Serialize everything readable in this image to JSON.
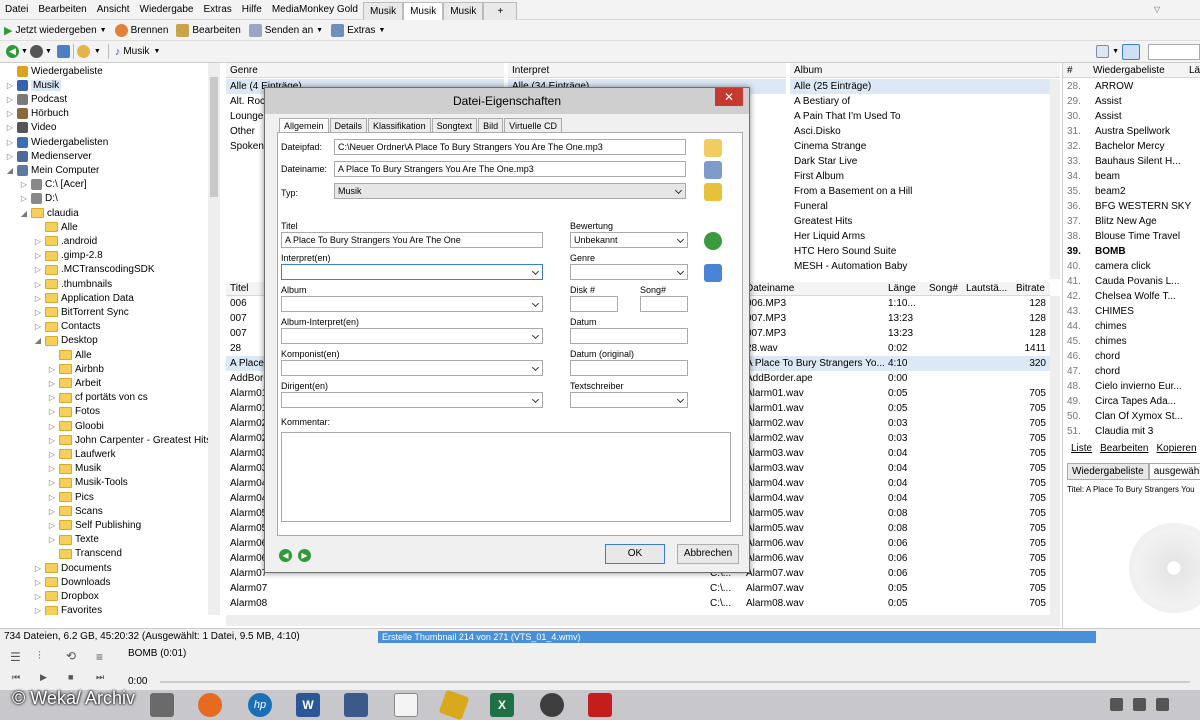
{
  "menu": {
    "items": [
      "Datei",
      "Bearbeiten",
      "Ansicht",
      "Wiedergabe",
      "Extras",
      "Hilfe",
      "MediaMonkey Gold"
    ],
    "tabs": [
      "Musik",
      "Musik",
      "Musik"
    ],
    "add_tab": "+"
  },
  "toolbar": {
    "play_now": "Jetzt wiedergeben",
    "burn": "Brennen",
    "edit": "Bearbeiten",
    "send_to": "Senden an",
    "extras": "Extras"
  },
  "nav": {
    "location": "Musik"
  },
  "tree": [
    {
      "label": "Wiedergabeliste",
      "d": 0,
      "exp": "",
      "icon": "now-playing-icon"
    },
    {
      "label": "Musik",
      "d": 0,
      "exp": "▷",
      "icon": "music-note-icon"
    },
    {
      "label": "Podcast",
      "d": 0,
      "exp": "▷",
      "icon": "podcast-icon"
    },
    {
      "label": "Hörbuch",
      "d": 0,
      "exp": "▷",
      "icon": "audiobook-icon"
    },
    {
      "label": "Video",
      "d": 0,
      "exp": "▷",
      "icon": "video-icon"
    },
    {
      "label": "Wiedergabelisten",
      "d": 0,
      "exp": "▷",
      "icon": "playlists-icon"
    },
    {
      "label": "Medienserver",
      "d": 0,
      "exp": "▷",
      "icon": "media-server-icon"
    },
    {
      "label": "Mein Computer",
      "d": 0,
      "exp": "◢",
      "icon": "computer-icon"
    },
    {
      "label": "C:\\ [Acer]",
      "d": 1,
      "exp": "▷",
      "icon": "drive-icon"
    },
    {
      "label": "D:\\",
      "d": 1,
      "exp": "▷",
      "icon": "drive-icon"
    },
    {
      "label": "claudia",
      "d": 1,
      "exp": "◢",
      "icon": "folder-icon"
    },
    {
      "label": "Alle",
      "d": 2,
      "exp": "",
      "icon": "folder-icon"
    },
    {
      "label": ".android",
      "d": 2,
      "exp": "▷",
      "icon": "folder-icon"
    },
    {
      "label": ".gimp-2.8",
      "d": 2,
      "exp": "▷",
      "icon": "folder-icon"
    },
    {
      "label": ".MCTranscodingSDK",
      "d": 2,
      "exp": "▷",
      "icon": "folder-icon"
    },
    {
      "label": ".thumbnails",
      "d": 2,
      "exp": "▷",
      "icon": "folder-icon"
    },
    {
      "label": "Application Data",
      "d": 2,
      "exp": "▷",
      "icon": "folder-icon"
    },
    {
      "label": "BitTorrent Sync",
      "d": 2,
      "exp": "▷",
      "icon": "folder-icon"
    },
    {
      "label": "Contacts",
      "d": 2,
      "exp": "▷",
      "icon": "folder-icon"
    },
    {
      "label": "Desktop",
      "d": 2,
      "exp": "◢",
      "icon": "folder-icon"
    },
    {
      "label": "Alle",
      "d": 3,
      "exp": "",
      "icon": "folder-icon"
    },
    {
      "label": "Airbnb",
      "d": 3,
      "exp": "▷",
      "icon": "folder-icon"
    },
    {
      "label": "Arbeit",
      "d": 3,
      "exp": "▷",
      "icon": "folder-icon"
    },
    {
      "label": "cf portäts von cs",
      "d": 3,
      "exp": "▷",
      "icon": "folder-icon"
    },
    {
      "label": "Fotos",
      "d": 3,
      "exp": "▷",
      "icon": "folder-icon"
    },
    {
      "label": "Gloobi",
      "d": 3,
      "exp": "▷",
      "icon": "folder-icon"
    },
    {
      "label": "John Carpenter - Greatest Hits",
      "d": 3,
      "exp": "▷",
      "icon": "folder-icon"
    },
    {
      "label": "Laufwerk",
      "d": 3,
      "exp": "▷",
      "icon": "folder-icon"
    },
    {
      "label": "Musik",
      "d": 3,
      "exp": "▷",
      "icon": "folder-icon"
    },
    {
      "label": "Musik-Tools",
      "d": 3,
      "exp": "▷",
      "icon": "folder-icon"
    },
    {
      "label": "Pics",
      "d": 3,
      "exp": "▷",
      "icon": "folder-icon"
    },
    {
      "label": "Scans",
      "d": 3,
      "exp": "▷",
      "icon": "folder-icon"
    },
    {
      "label": "Self Publishing",
      "d": 3,
      "exp": "▷",
      "icon": "folder-icon"
    },
    {
      "label": "Texte",
      "d": 3,
      "exp": "▷",
      "icon": "folder-icon"
    },
    {
      "label": "Transcend",
      "d": 3,
      "exp": "",
      "icon": "folder-icon"
    },
    {
      "label": "Documents",
      "d": 2,
      "exp": "▷",
      "icon": "folder-icon"
    },
    {
      "label": "Downloads",
      "d": 2,
      "exp": "▷",
      "icon": "folder-icon"
    },
    {
      "label": "Dropbox",
      "d": 2,
      "exp": "▷",
      "icon": "folder-icon"
    },
    {
      "label": "Favorites",
      "d": 2,
      "exp": "▷",
      "icon": "folder-icon"
    }
  ],
  "genre": {
    "header": "Genre",
    "items": [
      "Alle (4 Einträge)",
      "Alt. Rock",
      "Lounge",
      "Other",
      "Spoken"
    ]
  },
  "artist": {
    "header": "Interpret",
    "items": [
      "Alle (34 Einträge)"
    ]
  },
  "album": {
    "header": "Album",
    "items": [
      "Alle (25 Einträge)",
      "A Bestiary of",
      "A Pain That I'm Used To",
      "Asci.Disko",
      "Cinema Strange",
      "Dark Star Live",
      "First Album",
      "From a Basement on a Hill",
      "Funeral",
      "Greatest Hits",
      "Her Liquid Arms",
      "HTC Hero Sound Suite",
      "MESH - Automation Baby"
    ]
  },
  "tracks": {
    "headers": {
      "title": "Titel",
      "filename": "Dateiname",
      "length": "Länge",
      "song": "Song#",
      "loud": "Lautstä...",
      "bitrate": "Bitrate"
    },
    "rows": [
      {
        "title": "006",
        "path": "",
        "file": "006.MP3",
        "len": "1:10...",
        "br": "128"
      },
      {
        "title": "007",
        "path": "",
        "file": "007.MP3",
        "len": "13:23",
        "br": "128"
      },
      {
        "title": "007",
        "path": "",
        "file": "007.MP3",
        "len": "13:23",
        "br": "128"
      },
      {
        "title": "28",
        "path": "",
        "file": "28.wav",
        "len": "0:02",
        "br": "1411"
      },
      {
        "title": "A Place To Bury Strangers You Are The One",
        "path": "",
        "file": "A Place To Bury Strangers  Yo...",
        "len": "4:10",
        "br": "320"
      },
      {
        "title": "AddBorder",
        "path": "",
        "file": "AddBorder.ape",
        "len": "0:00",
        "br": ""
      },
      {
        "title": "Alarm01",
        "path": "",
        "file": "Alarm01.wav",
        "len": "0:05",
        "br": "705"
      },
      {
        "title": "Alarm01",
        "path": "",
        "file": "Alarm01.wav",
        "len": "0:05",
        "br": "705"
      },
      {
        "title": "Alarm02",
        "path": "",
        "file": "Alarm02.wav",
        "len": "0:03",
        "br": "705"
      },
      {
        "title": "Alarm02",
        "path": "",
        "file": "Alarm02.wav",
        "len": "0:03",
        "br": "705"
      },
      {
        "title": "Alarm03",
        "path": "",
        "file": "Alarm03.wav",
        "len": "0:04",
        "br": "705"
      },
      {
        "title": "Alarm03",
        "path": "",
        "file": "Alarm03.wav",
        "len": "0:04",
        "br": "705"
      },
      {
        "title": "Alarm04",
        "path": "",
        "file": "Alarm04.wav",
        "len": "0:04",
        "br": "705"
      },
      {
        "title": "Alarm04",
        "path": "",
        "file": "Alarm04.wav",
        "len": "0:04",
        "br": "705"
      },
      {
        "title": "Alarm05",
        "path": "",
        "file": "Alarm05.wav",
        "len": "0:08",
        "br": "705"
      },
      {
        "title": "Alarm05",
        "path": "",
        "file": "Alarm05.wav",
        "len": "0:08",
        "br": "705"
      },
      {
        "title": "Alarm06",
        "path": "",
        "file": "Alarm06.wav",
        "len": "0:06",
        "br": "705"
      },
      {
        "title": "Alarm06",
        "path": "",
        "file": "Alarm06.wav",
        "len": "0:06",
        "br": "705"
      },
      {
        "title": "Alarm07",
        "path": "C:\\...",
        "file": "Alarm07.wav",
        "len": "0:06",
        "br": "705"
      },
      {
        "title": "Alarm07",
        "path": "C:\\...",
        "file": "Alarm07.wav",
        "len": "0:05",
        "br": "705"
      },
      {
        "title": "Alarm08",
        "path": "C:\\...",
        "file": "Alarm08.wav",
        "len": "0:05",
        "br": "705"
      }
    ]
  },
  "playlist": {
    "hash": "#",
    "header": "Wiedergabeliste",
    "header2": "Lä",
    "rows": [
      {
        "n": "28.",
        "t": "ARROW",
        "b": false
      },
      {
        "n": "29.",
        "t": "Assist",
        "b": false
      },
      {
        "n": "30.",
        "t": "Assist",
        "b": false
      },
      {
        "n": "31.",
        "t": "Austra   Spellwork",
        "b": false
      },
      {
        "n": "32.",
        "t": "Bachelor   Mercy",
        "b": false
      },
      {
        "n": "33.",
        "t": "Bauhaus   Silent H...",
        "b": false
      },
      {
        "n": "34.",
        "t": "beam",
        "b": false
      },
      {
        "n": "35.",
        "t": "beam2",
        "b": false
      },
      {
        "n": "36.",
        "t": "BFG   WESTERN SKY",
        "b": false
      },
      {
        "n": "37.",
        "t": "Blitz New Age",
        "b": false
      },
      {
        "n": "38.",
        "t": "Blouse   Time Travel",
        "b": false
      },
      {
        "n": "39.",
        "t": "BOMB",
        "b": true
      },
      {
        "n": "40.",
        "t": "camera click",
        "b": false
      },
      {
        "n": "41.",
        "t": "Cauda Povanis   L...",
        "b": false
      },
      {
        "n": "42.",
        "t": "Chelsea Wolfe   T...",
        "b": false
      },
      {
        "n": "43.",
        "t": "CHIMES",
        "b": false
      },
      {
        "n": "44.",
        "t": "chimes",
        "b": false
      },
      {
        "n": "45.",
        "t": "chimes",
        "b": false
      },
      {
        "n": "46.",
        "t": "chord",
        "b": false
      },
      {
        "n": "47.",
        "t": "chord",
        "b": false
      },
      {
        "n": "48.",
        "t": "Cielo invierno Eur...",
        "b": false
      },
      {
        "n": "49.",
        "t": "Circa Tapes   Ada...",
        "b": false
      },
      {
        "n": "50.",
        "t": "Clan Of Xymox St...",
        "b": false
      },
      {
        "n": "51.",
        "t": "Claudia mit 3",
        "b": false
      }
    ],
    "actions": [
      "Liste",
      "Bearbeiten",
      "Kopieren"
    ],
    "tabs": [
      "Wiedergabeliste",
      "ausgewählte"
    ],
    "info": "Titel: A Place To Bury Strangers   You"
  },
  "dialog": {
    "title": "Datei-Eigenschaften",
    "close": "✕",
    "tabs": [
      "Allgemein",
      "Details",
      "Klassifikation",
      "Songtext",
      "Bild",
      "Virtuelle CD"
    ],
    "path_label": "Dateipfad:",
    "path_value": "C:\\Neuer Ordner\\A Place To Bury Strangers  You Are The One.mp3",
    "name_label": "Dateiname:",
    "name_value": "A Place To Bury Strangers  You Are The One.mp3",
    "type_label": "Typ:",
    "type_value": "Musik",
    "title_label": "Titel",
    "title_value": "A Place To Bury Strangers  You Are The One",
    "rating_label": "Bewertung",
    "rating_value": "Unbekannt",
    "artist_label": "Interpret(en)",
    "artist_value": "",
    "genre_label": "Genre",
    "genre_value": "",
    "album_label": "Album",
    "album_value": "",
    "disc_label": "Disk #",
    "disc_value": "",
    "song_label": "Song#",
    "song_value": "",
    "album_artist_label": "Album-Interpret(en)",
    "album_artist_value": "",
    "date_label": "Datum",
    "date_value": "",
    "composer_label": "Komponist(en)",
    "composer_value": "",
    "orig_date_label": "Datum (original)",
    "orig_date_value": "",
    "conductor_label": "Dirigent(en)",
    "conductor_value": "",
    "lyricist_label": "Textschreiber",
    "lyricist_value": "",
    "comment_label": "Kommentar:",
    "comment_value": "",
    "ok": "OK",
    "cancel": "Abbrechen"
  },
  "status": {
    "left": "734 Dateien, 6.2 GB, 45:20:32 (Ausgewählt: 1 Datei, 9.5 MB, 4:10)",
    "progress": "Erstelle Thumbnail 214 von 271 (VTS_01_4.wmv)"
  },
  "player": {
    "now_playing": "BOMB (0:01)",
    "time": "0:00"
  },
  "watermark": "© Weka/ Archiv",
  "colors": {
    "accent": "#3a7fd0",
    "close_red": "#c7392f",
    "status_bar": "#4a90d9",
    "taskbar": "#c7c7cc"
  }
}
